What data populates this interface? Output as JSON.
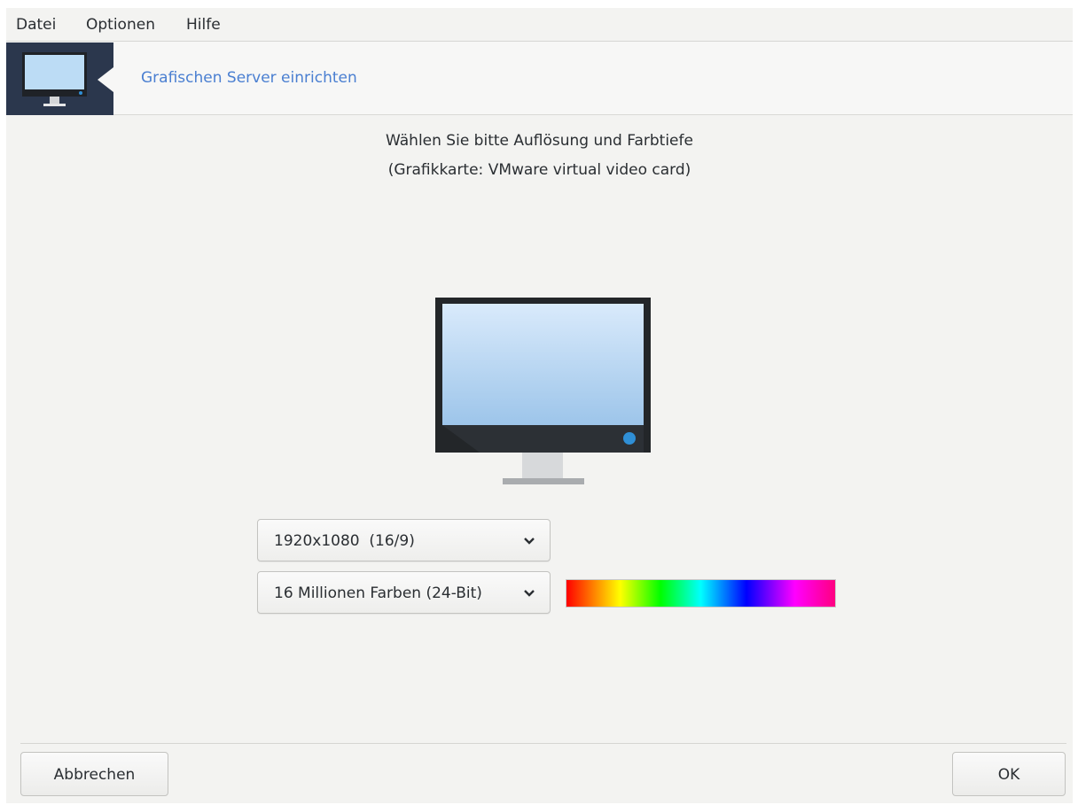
{
  "menu": {
    "items": [
      "Datei",
      "Optionen",
      "Hilfe"
    ]
  },
  "banner": {
    "title": "Grafischen Server einrichten",
    "icon": "monitor-icon"
  },
  "prompt": {
    "line1": "Wählen Sie bitte Auflösung und Farbtiefe",
    "line2": "(Grafikkarte: VMware virtual video card)"
  },
  "resolution_select": {
    "value": "1920x1080  (16/9)"
  },
  "color_depth_select": {
    "value": "16 Millionen Farben (24-Bit)"
  },
  "buttons": {
    "cancel": "Abbrechen",
    "ok": "OK"
  },
  "colors": {
    "banner_bg": "#2b374d",
    "banner_title": "#4a7fd1",
    "window_bg": "#f3f3f1"
  }
}
